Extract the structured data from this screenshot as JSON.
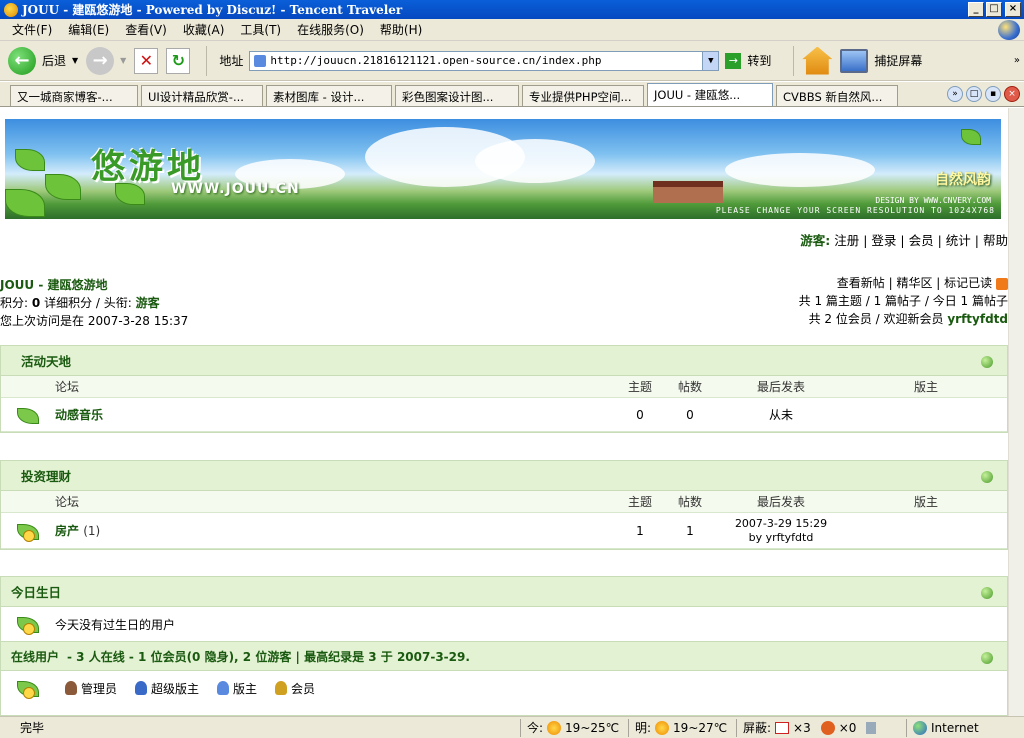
{
  "window": {
    "title": "JOUU - 建瓯悠游地 - Powered by Discuz! - Tencent Traveler"
  },
  "menu": [
    "文件(F)",
    "编辑(E)",
    "查看(V)",
    "收藏(A)",
    "工具(T)",
    "在线服务(O)",
    "帮助(H)"
  ],
  "toolbar": {
    "back_label": "后退",
    "address_label": "地址",
    "address_value": "http://jouucn.21816121121.open-source.cn/index.php",
    "go_label": "转到",
    "capture_label": "捕捉屏幕"
  },
  "tabs": [
    "又一城商家博客-...",
    "UI设计精品欣赏-...",
    "素材图库 - 设计...",
    "彩色图案设计图...",
    "专业提供PHP空间...",
    "JOUU - 建瓯悠...",
    "CVBBS 新自然风..."
  ],
  "banner": {
    "logo": "悠游地",
    "url": "WWW.JOUU.CN",
    "tagline": "自然风韵",
    "design_credit": "DESIGN BY WWW.CNVERY.COM",
    "resolution_note": "PLEASE CHANGE YOUR SCREEN RESOLUTION TO 1024X768"
  },
  "guest_bar": {
    "label": "游客:",
    "links": [
      "注册",
      "登录",
      "会员",
      "统计",
      "帮助"
    ]
  },
  "site_info": {
    "name": "JOUU - 建瓯悠游地",
    "points_label": "积分:",
    "points": "0",
    "detail_label": "详细积分 / 头衔:",
    "rank": "游客",
    "last_visit": "您上次访问是在 2007-3-28 15:37"
  },
  "stats": {
    "links": [
      "查看新帖",
      "精华区",
      "标记已读"
    ],
    "line2": "共 1 篇主题 / 1 篇帖子 / 今日 1 篇帖子",
    "line3_prefix": "共 2 位会员 / 欢迎新会员",
    "new_member": "yrftyfdtd"
  },
  "columns": {
    "forum": "论坛",
    "topics": "主题",
    "posts": "帖数",
    "last_post": "最后发表",
    "moderator": "版主"
  },
  "categories": [
    {
      "title": "活动天地",
      "forums": [
        {
          "name": "动感音乐",
          "count": "",
          "topics": "0",
          "posts": "0",
          "last_post": "从未",
          "last_by": ""
        }
      ]
    },
    {
      "title": "投资理财",
      "forums": [
        {
          "name": "房产",
          "count": "(1)",
          "topics": "1",
          "posts": "1",
          "last_post": "2007-3-29 15:29",
          "last_by": "by yrftyfdtd"
        }
      ]
    }
  ],
  "birthday": {
    "title": "今日生日",
    "text": "今天没有过生日的用户"
  },
  "online": {
    "title": "在线用户",
    "summary": "- 3 人在线 - 1 位会员(0 隐身), 2 位游客 | 最高纪录是 3 于 2007-3-29.",
    "legend": [
      "管理员",
      "超级版主",
      "版主",
      "会员"
    ]
  },
  "statusbar": {
    "status": "完毕",
    "today_label": "今:",
    "today_temp": "19~25℃",
    "tomorrow_label": "明:",
    "tomorrow_temp": "19~27℃",
    "block_label": "屏蔽:",
    "popups": "×3",
    "ads": "×0",
    "zone": "Internet"
  }
}
